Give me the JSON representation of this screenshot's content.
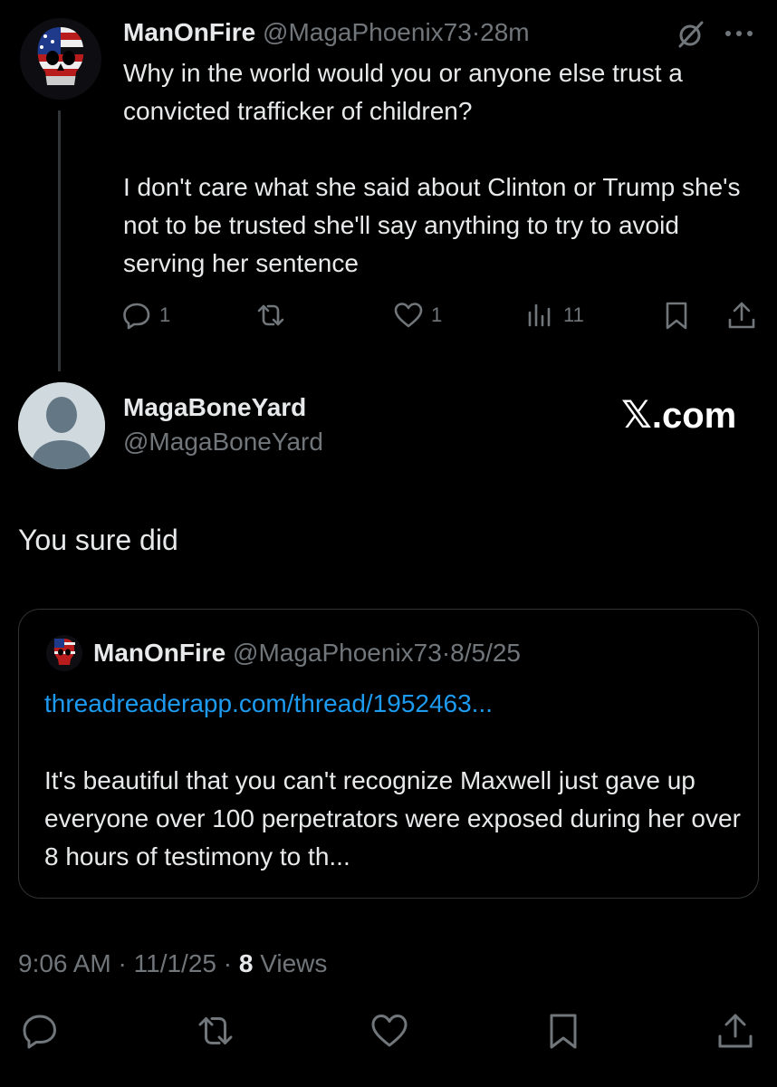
{
  "parent": {
    "name": "ManOnFire",
    "handle": "@MagaPhoenix73",
    "separator": "·",
    "time": "28m",
    "paragraphs": [
      "Why in the world would you or anyone else trust a convicted trafficker of children?",
      "I don't care what she said about Clinton or Trump she's not to be trusted she'll say anything to try to avoid serving her sentence"
    ],
    "actions": {
      "replies": "1",
      "reposts": "",
      "likes": "1",
      "views": "11"
    }
  },
  "main": {
    "name": "MagaBoneYard",
    "handle": "@MagaBoneYard",
    "watermark_logo": "𝕏",
    "watermark_text": ".com",
    "text": "You sure did"
  },
  "quote": {
    "name": "ManOnFire",
    "handle": "@MagaPhoenix73",
    "separator": "·",
    "date": "8/5/25",
    "link": "threadreaderapp.com/thread/1952463...",
    "text": "It's beautiful that you can't recognize Maxwell just gave up everyone over 100 perpetrators were exposed during her over 8 hours of testimony to th..."
  },
  "meta": {
    "time": "9:06 AM",
    "sep1": " · ",
    "date": "11/1/25",
    "sep2": " · ",
    "views_count": "8",
    "views_label": " Views"
  },
  "colors": {
    "background": "#000000",
    "text": "#e7e9ea",
    "muted": "#71767b",
    "link": "#1d9bf0",
    "border": "#2f3336"
  },
  "icons": {
    "reply": "reply-icon",
    "repost": "repost-icon",
    "like": "heart-icon",
    "views": "views-icon",
    "bookmark": "bookmark-icon",
    "share": "share-icon",
    "grok": "grok-icon",
    "more": "more-icon"
  }
}
